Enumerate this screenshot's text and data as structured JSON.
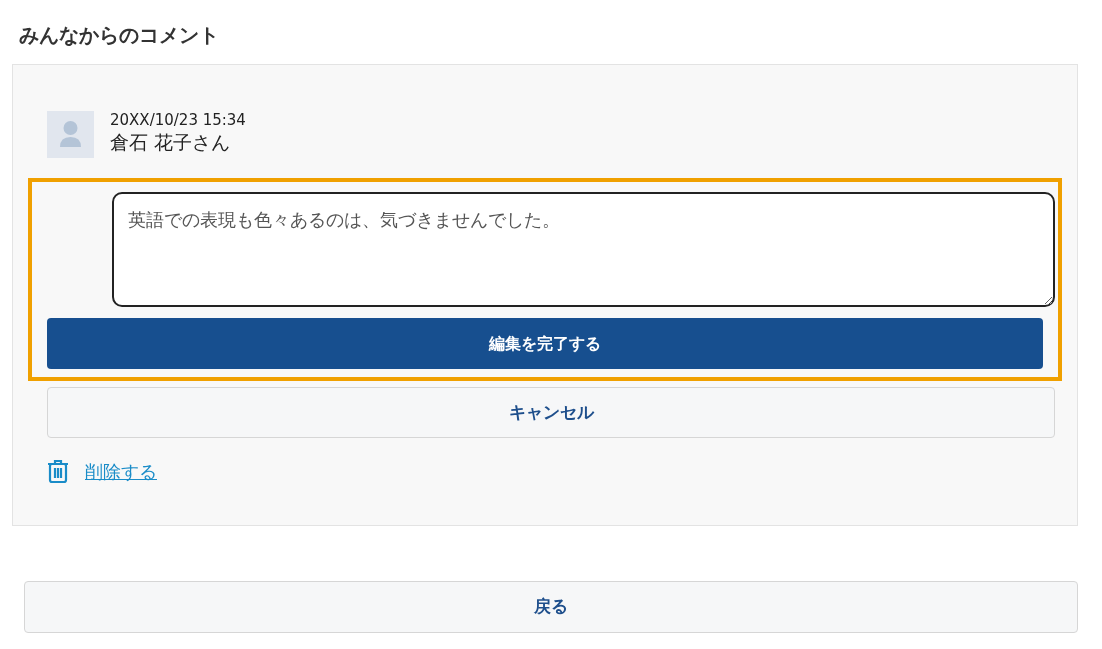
{
  "heading": "みんなからのコメント",
  "comment": {
    "timestamp": "20XX/10/23 15:34",
    "author": "倉石 花子さん",
    "value": "英語での表現も色々あるのは、気づきませんでした。",
    "highlighted": true
  },
  "buttons": [
    {
      "kind": "primary",
      "label": "編集を完了する"
    },
    {
      "kind": "secondary",
      "label": "キャンセル"
    }
  ],
  "delete_link": "削除する",
  "back_button": "戻る"
}
